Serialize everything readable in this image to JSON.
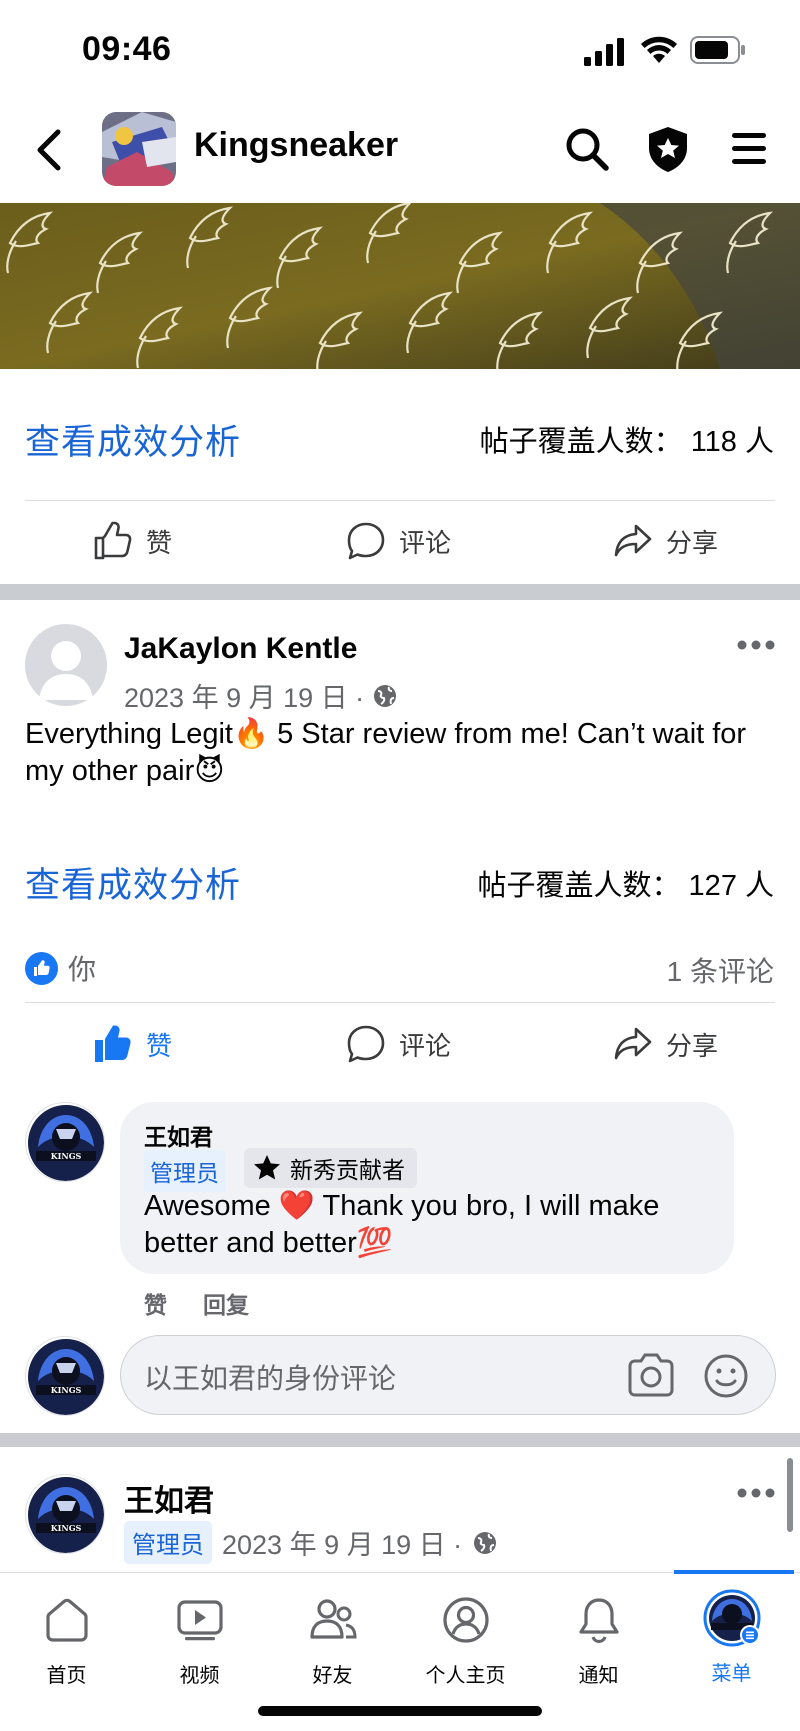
{
  "status_bar": {
    "time": "09:46"
  },
  "header": {
    "title": "Kingsneaker"
  },
  "post1": {
    "insights_link": "查看成效分析",
    "reach": "帖子覆盖人数： 118 人",
    "actions": {
      "like": "赞",
      "comment": "评论",
      "share": "分享"
    }
  },
  "post2": {
    "author": "JaKaylon Kentle",
    "date": "2023 年 9 月 19 日 ·",
    "text": "Everything Legit🔥 5 Star review from me! Can’t wait for my other pair😈",
    "insights_link": "查看成效分析",
    "reach": "帖子覆盖人数： 127 人",
    "likes_by": "你",
    "comment_count": "1 条评论",
    "actions": {
      "like": "赞",
      "comment": "评论",
      "share": "分享"
    },
    "comment": {
      "author": "王如君",
      "role": "管理员",
      "badge": "新秀贡献者",
      "text": "Awesome ❤️  Thank you bro, I will make better and better💯",
      "like": "赞",
      "reply": "回复"
    },
    "reply_placeholder": "以王如君的身份评论"
  },
  "post3": {
    "author": "王如君",
    "role": "管理员",
    "date": "2023 年 9 月 19 日 ·"
  },
  "bottom_nav": [
    {
      "label": "首页",
      "icon": "home-icon"
    },
    {
      "label": "视频",
      "icon": "video-icon"
    },
    {
      "label": "好友",
      "icon": "friends-icon"
    },
    {
      "label": "个人主页",
      "icon": "profile-icon"
    },
    {
      "label": "通知",
      "icon": "bell-icon"
    },
    {
      "label": "菜单",
      "icon": "menu-avatar-icon"
    }
  ],
  "colors": {
    "accent": "#1877f2",
    "link": "#1a65d6",
    "cover": "#5f5418"
  }
}
